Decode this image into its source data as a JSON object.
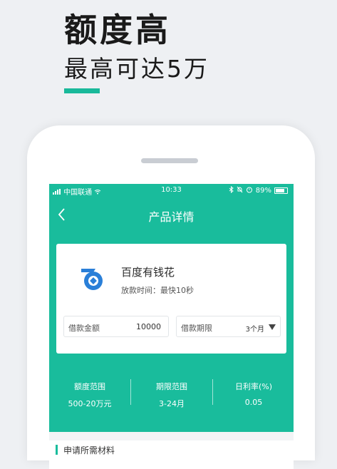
{
  "promo": {
    "headline": "额度高",
    "subline": "最高可达5万"
  },
  "status_bar": {
    "carrier": "中国联通",
    "time": "10:33",
    "battery": "89%"
  },
  "nav": {
    "title": "产品详情"
  },
  "product": {
    "name": "百度有钱花",
    "subtitle": "放款时间：最快10秒",
    "amount_label": "借款金额",
    "amount_value": "10000",
    "term_label": "借款期限",
    "term_value": "3个月"
  },
  "stats": [
    {
      "label": "额度范围",
      "value": "500-20万元"
    },
    {
      "label": "期限范围",
      "value": "3-24月"
    },
    {
      "label": "日利率(%)",
      "value": "0.05"
    }
  ],
  "section": {
    "title": "申请所需材料"
  },
  "colors": {
    "accent": "#19bc9c",
    "page_bg": "#eef0f3",
    "logo_blue": "#2a7fd8"
  },
  "icons": [
    "back-arrow-icon",
    "baidu-logo-icon",
    "dropdown-caret-icon",
    "signal-icon",
    "wifi-icon",
    "bluetooth-icon",
    "bell-icon",
    "alarm-icon",
    "battery-icon"
  ]
}
